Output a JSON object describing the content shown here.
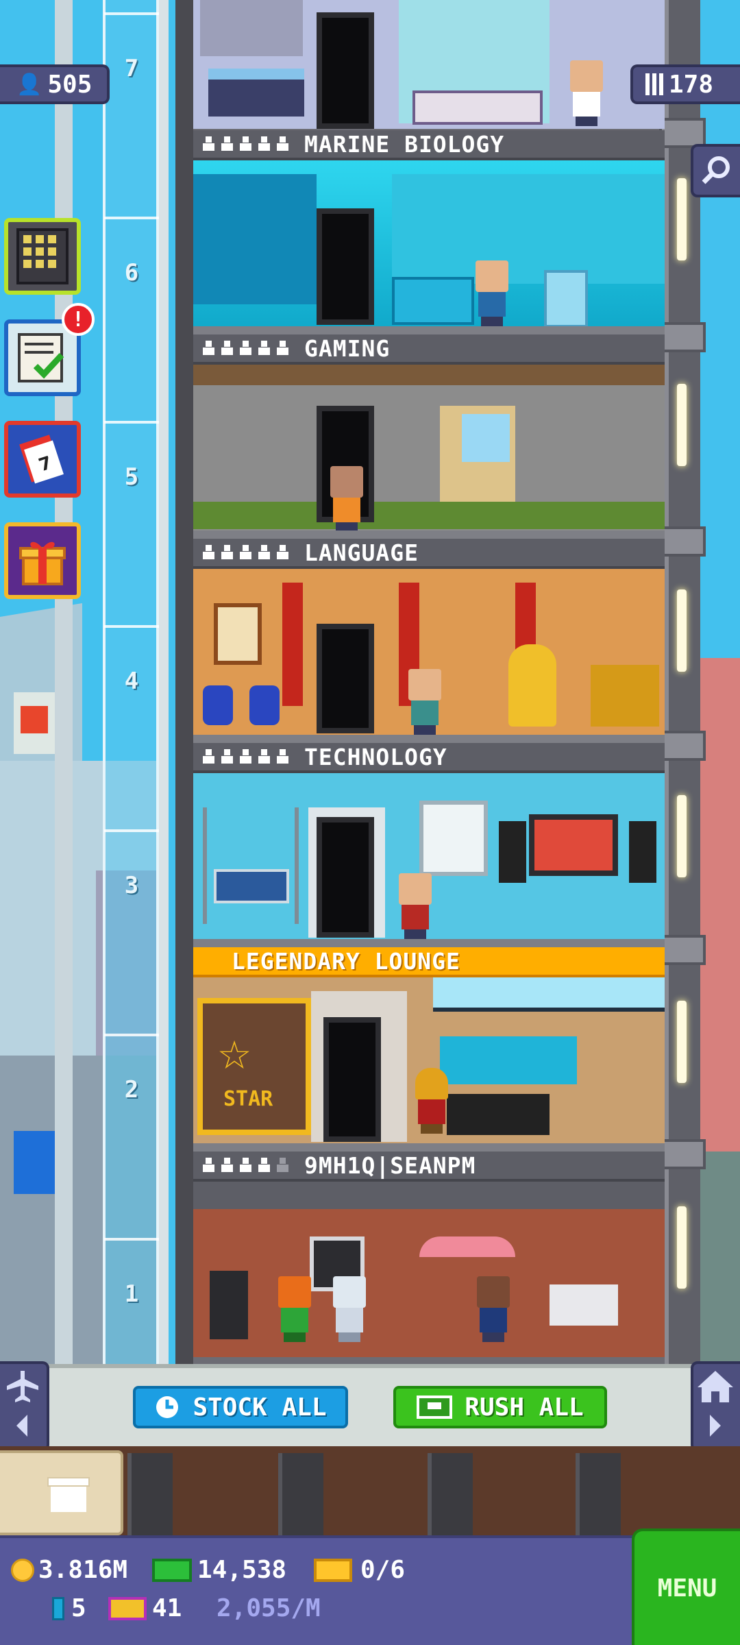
{
  "top_badges": {
    "population": "505",
    "floors": "178"
  },
  "shaft_numbers": [
    "7",
    "6",
    "5",
    "4",
    "3",
    "2",
    "1"
  ],
  "floors": [
    {
      "name": "MARINE BIOLOGY",
      "residents": 5
    },
    {
      "name": "GAMING",
      "residents": 5
    },
    {
      "name": "LANGUAGE",
      "residents": 5
    },
    {
      "name": "TECHNOLOGY",
      "residents": 5
    },
    {
      "name": "LEGENDARY LOUNGE",
      "residents": 0
    },
    {
      "name": "9MH1Q|SEANPM",
      "residents": 4
    }
  ],
  "notification_count": "!",
  "actions": {
    "stock_all": "STOCK ALL",
    "rush_all": "RUSH ALL"
  },
  "lounge_sign": "STAR",
  "hud": {
    "coins": "3.816M",
    "bux": "14,538",
    "tickets": "0/6",
    "keys": "5",
    "vip": "41",
    "rate": "2,055/M",
    "menu": "MENU"
  },
  "colors": {
    "sky": "#43c1ee",
    "stock_button": "#1c9ee3",
    "rush_button": "#3bc31e",
    "hud_bar": "#57589b",
    "legendary_label": "#ffae00",
    "menu_button": "#2ab51f"
  },
  "icons": [
    "population-icon",
    "floors-grid-icon",
    "search-icon",
    "elevator-building-icon",
    "checklist-icon",
    "calendar-icon",
    "gift-icon",
    "clock-icon",
    "bux-icon",
    "coin-icon",
    "ticket-icon",
    "key-icon",
    "vip-icon",
    "elevator-arrow-icon",
    "home-icon"
  ]
}
